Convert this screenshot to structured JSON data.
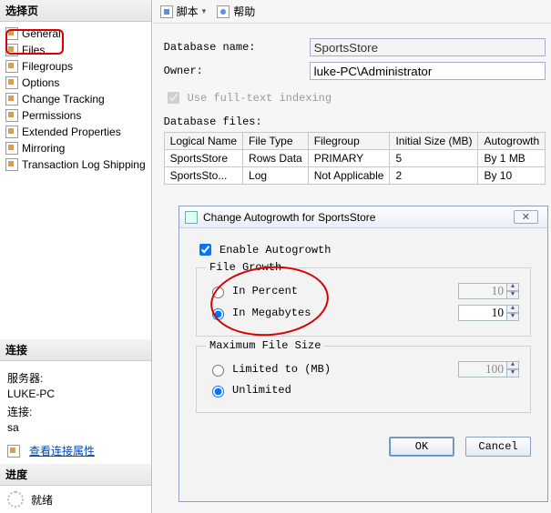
{
  "left": {
    "select_header": "选择页",
    "conn_header": "连接",
    "progress_header": "进度",
    "tree": [
      "General",
      "Files",
      "Filegroups",
      "Options",
      "Change Tracking",
      "Permissions",
      "Extended Properties",
      "Mirroring",
      "Transaction Log Shipping"
    ],
    "server_label": "服务器:",
    "server_value": "LUKE-PC",
    "conn_label": "连接:",
    "conn_value": "sa",
    "view_props": "查看连接属性",
    "ready": "就绪"
  },
  "toolbar": {
    "script": "脚本",
    "help": "帮助"
  },
  "form": {
    "dbname_label": "Database name:",
    "dbname_value": "SportsStore",
    "owner_label": "Owner:",
    "owner_value": "luke-PC\\Administrator",
    "fulltext": "Use full-text indexing",
    "files_label": "Database files:"
  },
  "grid": {
    "headers": [
      "Logical Name",
      "File Type",
      "Filegroup",
      "Initial Size (MB)",
      "Autogrowth"
    ],
    "rows": [
      [
        "SportsStore",
        "Rows Data",
        "PRIMARY",
        "5",
        "By 1 MB"
      ],
      [
        "SportsSto...",
        "Log",
        "Not Applicable",
        "2",
        "By 10"
      ]
    ]
  },
  "dialog": {
    "title": "Change Autogrowth for SportsStore",
    "enable": "Enable Autogrowth",
    "file_growth_legend": "File Growth",
    "in_percent": "In Percent",
    "in_mb": "In Megabytes",
    "percent_val": "10",
    "mb_val": "10",
    "maxsize_legend": "Maximum File Size",
    "limited": "Limited to (MB)",
    "unlimited": "Unlimited",
    "limited_val": "100",
    "ok": "OK",
    "cancel": "Cancel",
    "close_glyph": "✕"
  }
}
